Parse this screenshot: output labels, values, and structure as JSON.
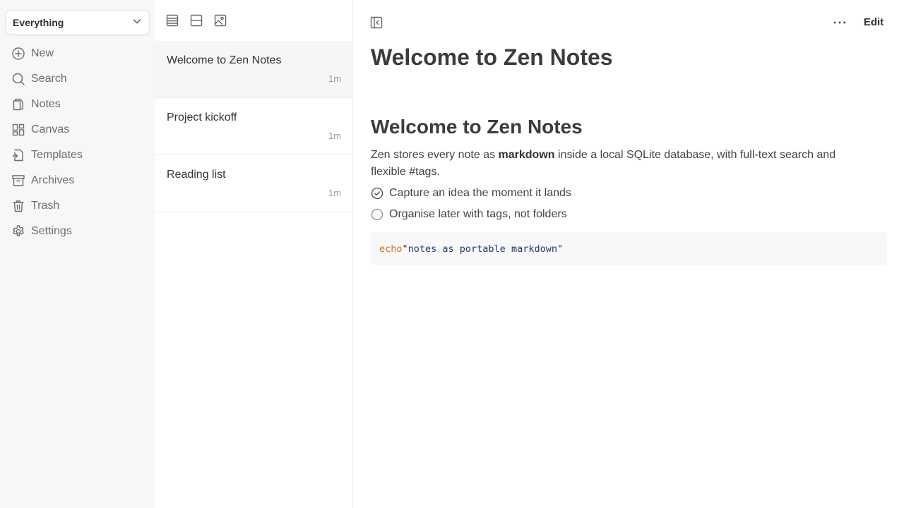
{
  "sidebar": {
    "filter": {
      "value": "Everything"
    },
    "items": [
      {
        "label": "New",
        "icon": "plus-circle-icon"
      },
      {
        "label": "Search",
        "icon": "search-icon"
      },
      {
        "label": "Notes",
        "icon": "notes-icon"
      },
      {
        "label": "Canvas",
        "icon": "canvas-icon"
      },
      {
        "label": "Templates",
        "icon": "template-icon"
      },
      {
        "label": "Archives",
        "icon": "archive-icon"
      },
      {
        "label": "Trash",
        "icon": "trash-icon"
      },
      {
        "label": "Settings",
        "icon": "gear-icon"
      }
    ]
  },
  "list": {
    "toolbar": [
      "list-view-icon",
      "card-view-icon",
      "gallery-view-icon"
    ],
    "notes": [
      {
        "title": "Welcome to Zen Notes",
        "time": "1m",
        "active": true
      },
      {
        "title": "Project kickoff",
        "time": "1m",
        "active": false
      },
      {
        "title": "Reading list",
        "time": "1m",
        "active": false
      }
    ]
  },
  "editor": {
    "toolbar": {
      "edit_label": "Edit"
    },
    "title": "Welcome to Zen Notes",
    "body": {
      "heading": "Welcome to Zen Notes",
      "para_before": "Zen stores every note as ",
      "para_bold": "markdown",
      "para_after": " inside a local SQLite database, with full-text search and flexible #tags.",
      "tasks": [
        {
          "label": "Capture an idea the moment it lands",
          "done": true
        },
        {
          "label": "Organise later with tags, not folders",
          "done": false
        }
      ],
      "code": {
        "keyword": "echo",
        "string": "\"notes as portable markdown\""
      }
    }
  },
  "colors": {
    "sidebar_bg": "#f7f7f7",
    "active_row_bg": "#f6f6f6",
    "code_keyword": "#d16d16",
    "code_string": "#1d3b6e"
  }
}
